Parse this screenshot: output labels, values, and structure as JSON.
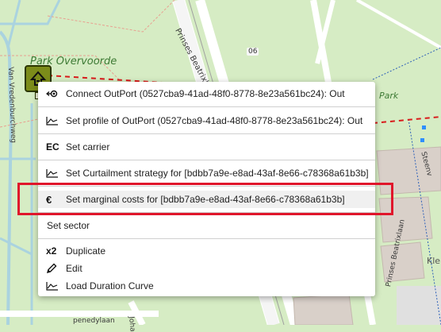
{
  "map": {
    "park_label": "Park Overvoorde",
    "park_label_right": "Park",
    "streets": {
      "prinses": "Prinses Beatrixlaan",
      "vreden": "Van Vredenburchweg",
      "beatrix2": "Prinses Beatrixlaan",
      "steen": "Steenv",
      "kle": "Kle",
      "penedy": "penedylaan",
      "joha": "Joha"
    },
    "road_number": "06",
    "asset_icon": "energy-asset-icon"
  },
  "context_menu": {
    "connect_outport": "Connect OutPort (0527cba9-41ad-48f0-8778-8e23a561bc24): Out",
    "set_profile": "Set profile of OutPort (0527cba9-41ad-48f0-8778-8e23a561bc24): Out",
    "set_carrier": "Set carrier",
    "carrier_icon_text": "EC",
    "set_curtailment": "Set Curtailment strategy for [bdbb7a9e-e8ad-43af-8e66-c78368a61b3b]",
    "set_marginal_costs": "Set marginal costs for [bdbb7a9e-e8ad-43af-8e66-c78368a61b3b]",
    "marginal_icon_text": "€",
    "set_sector": "Set sector",
    "duplicate": "Duplicate",
    "duplicate_icon_text": "x2",
    "edit": "Edit",
    "load_duration_curve": "Load Duration Curve"
  },
  "colors": {
    "highlight": "#e0162b",
    "park": "#d6ecc4",
    "asset": "#7c8c1a"
  }
}
